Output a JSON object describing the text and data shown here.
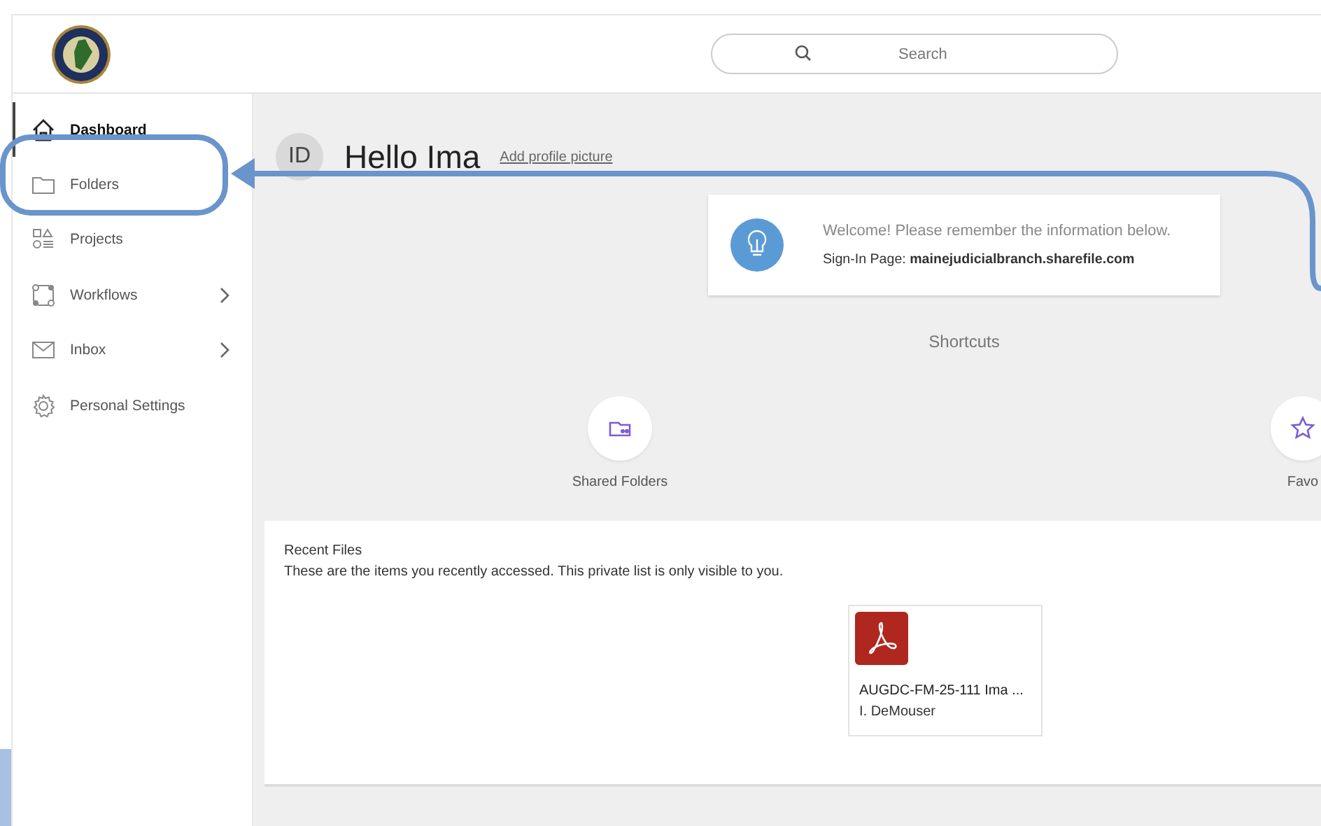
{
  "header": {
    "search": {
      "placeholder": "Search"
    }
  },
  "sidebar": {
    "items": [
      {
        "label": "Dashboard",
        "selected": true,
        "expandable": false
      },
      {
        "label": "Folders",
        "selected": false,
        "expandable": false
      },
      {
        "label": "Projects",
        "selected": false,
        "expandable": false
      },
      {
        "label": "Workflows",
        "selected": false,
        "expandable": true
      },
      {
        "label": "Inbox",
        "selected": false,
        "expandable": true
      },
      {
        "label": "Personal Settings",
        "selected": false,
        "expandable": false
      }
    ]
  },
  "greeting": {
    "initials": "ID",
    "text": "Hello Ima",
    "link": "Add profile picture"
  },
  "notice": {
    "message": "Welcome! Please remember the information below.",
    "detail": "Sign-In Page: **mainejudicialbranch.sharefile.com**"
  },
  "shortcuts": {
    "title": "Shortcuts",
    "items": [
      {
        "label": "Shared Folders"
      },
      {
        "label": "Favo"
      }
    ]
  },
  "recent": {
    "title": "Recent Files",
    "description": "These are the items you recently accessed. This private list is only visible to you.",
    "files": [
      {
        "name": "AUGDC-FM-25-111 Ima ...",
        "owner": "I. DeMouser"
      }
    ]
  }
}
